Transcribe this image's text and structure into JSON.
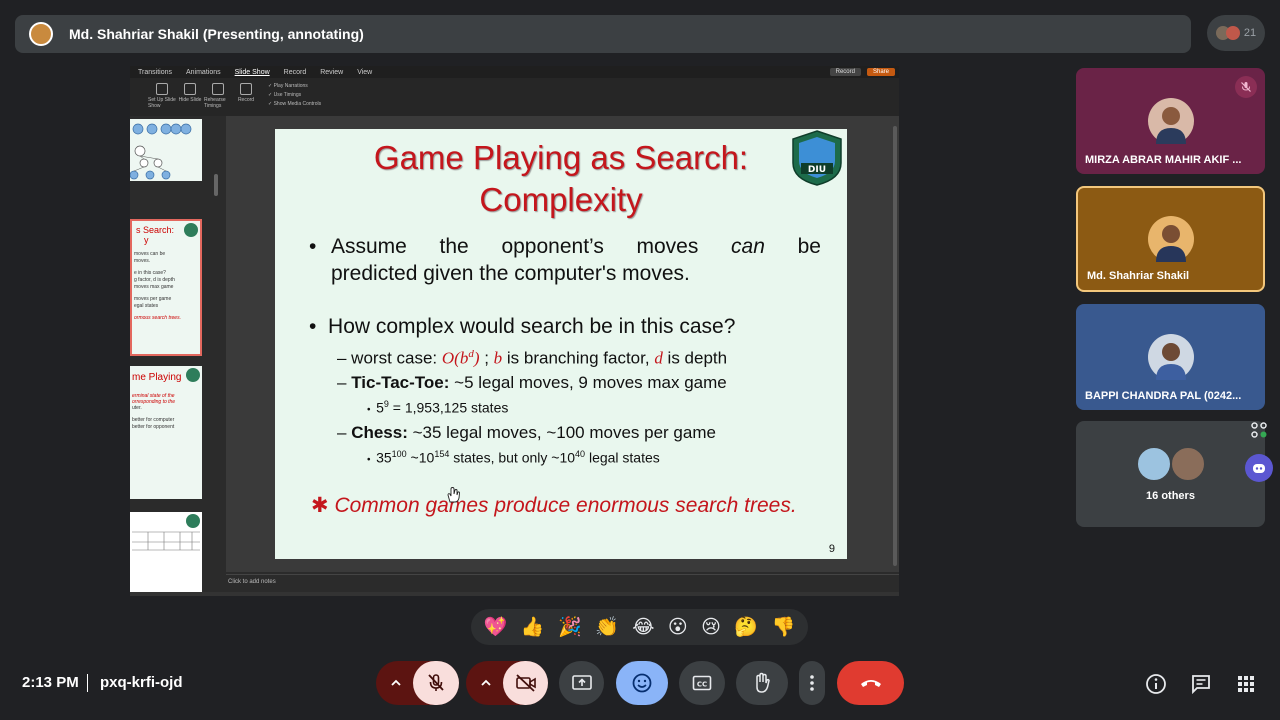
{
  "presenter": {
    "name": "Md. Shahriar Shakil (Presenting, annotating)"
  },
  "participant_count": "21",
  "ppt": {
    "tabs": [
      "Transitions",
      "Animations",
      "Slide Show",
      "Record",
      "Review",
      "View"
    ],
    "record_label": "Record",
    "share_label": "Share",
    "ribbon_buttons": [
      "Set Up Slide Show",
      "Hide Slide",
      "Rehearse Timings",
      "Record"
    ],
    "ribbon_checks": [
      "Play Narrations",
      "Use Timings",
      "Show Media Controls"
    ],
    "notes_placeholder": "Click to add notes",
    "thumb2": {
      "title": "s Search:",
      "title2": "y",
      "lines": [
        "moves   can   be",
        "moves.",
        "e in this case?",
        "g factor, d is depth",
        "moves max game",
        "moves per game",
        "egal states"
      ],
      "footer": "ormous search trees."
    },
    "thumb3": {
      "title": "me Playing",
      "lines": [
        "erminal state of the",
        "orresponding to the",
        "uter.",
        "better for computer",
        "better for opponent"
      ]
    }
  },
  "slide": {
    "title_line1": "Game Playing as Search:",
    "title_line2": "Complexity",
    "logo_text": "DIU",
    "bullet1_words": [
      "Assume",
      "the",
      "opponent’s",
      "moves",
      "can",
      "be"
    ],
    "bullet1_line2": "predicted given the computer's moves.",
    "bullet2": "How complex would search be in this case?",
    "worst_label": "– worst case: ",
    "worst_math": "O(b",
    "worst_sup": "d",
    "worst_math_close": ")",
    "worst_sep": " ;  ",
    "b_var": "b",
    "worst_mid": " is branching factor, ",
    "d_var": "d",
    "worst_end": " is depth",
    "ttt_label": "Tic-Tac-Toe:",
    "ttt_text": " ~5 legal moves, 9 moves max game",
    "ttt_sub_base": "5",
    "ttt_sub_exp": "9",
    "ttt_sub_rest": " = 1,953,125 states",
    "chess_label": "Chess:",
    "chess_text": " ~35 legal moves, ~100 moves per game",
    "chess_sub_base": "35",
    "chess_sub_exp": "100",
    "chess_sub_mid": " ~10",
    "chess_sub_exp2": "154",
    "chess_sub_mid2": " states, but only ~10",
    "chess_sub_exp3": "40",
    "chess_sub_end": " legal states",
    "conclusion": "Common games produce enormous search trees.",
    "slide_number": "9"
  },
  "tiles": [
    {
      "name": "MIRZA ABRAR MAHIR AKIF ..."
    },
    {
      "name": "Md. Shahriar Shakil"
    },
    {
      "name": "BAPPI CHANDRA PAL (0242..."
    },
    {
      "name": "16 others"
    }
  ],
  "reactions": [
    "💖",
    "👍",
    "🎉",
    "👏",
    "😂",
    "😮",
    "😢",
    "🤔",
    "👎"
  ],
  "meeting": {
    "time": "2:13 PM",
    "code": "pxq-krfi-ojd"
  },
  "colors": {
    "end_call": "#e03b30",
    "active_blue": "#8ab4f8",
    "mic_off_bg": "#f9dedc"
  }
}
